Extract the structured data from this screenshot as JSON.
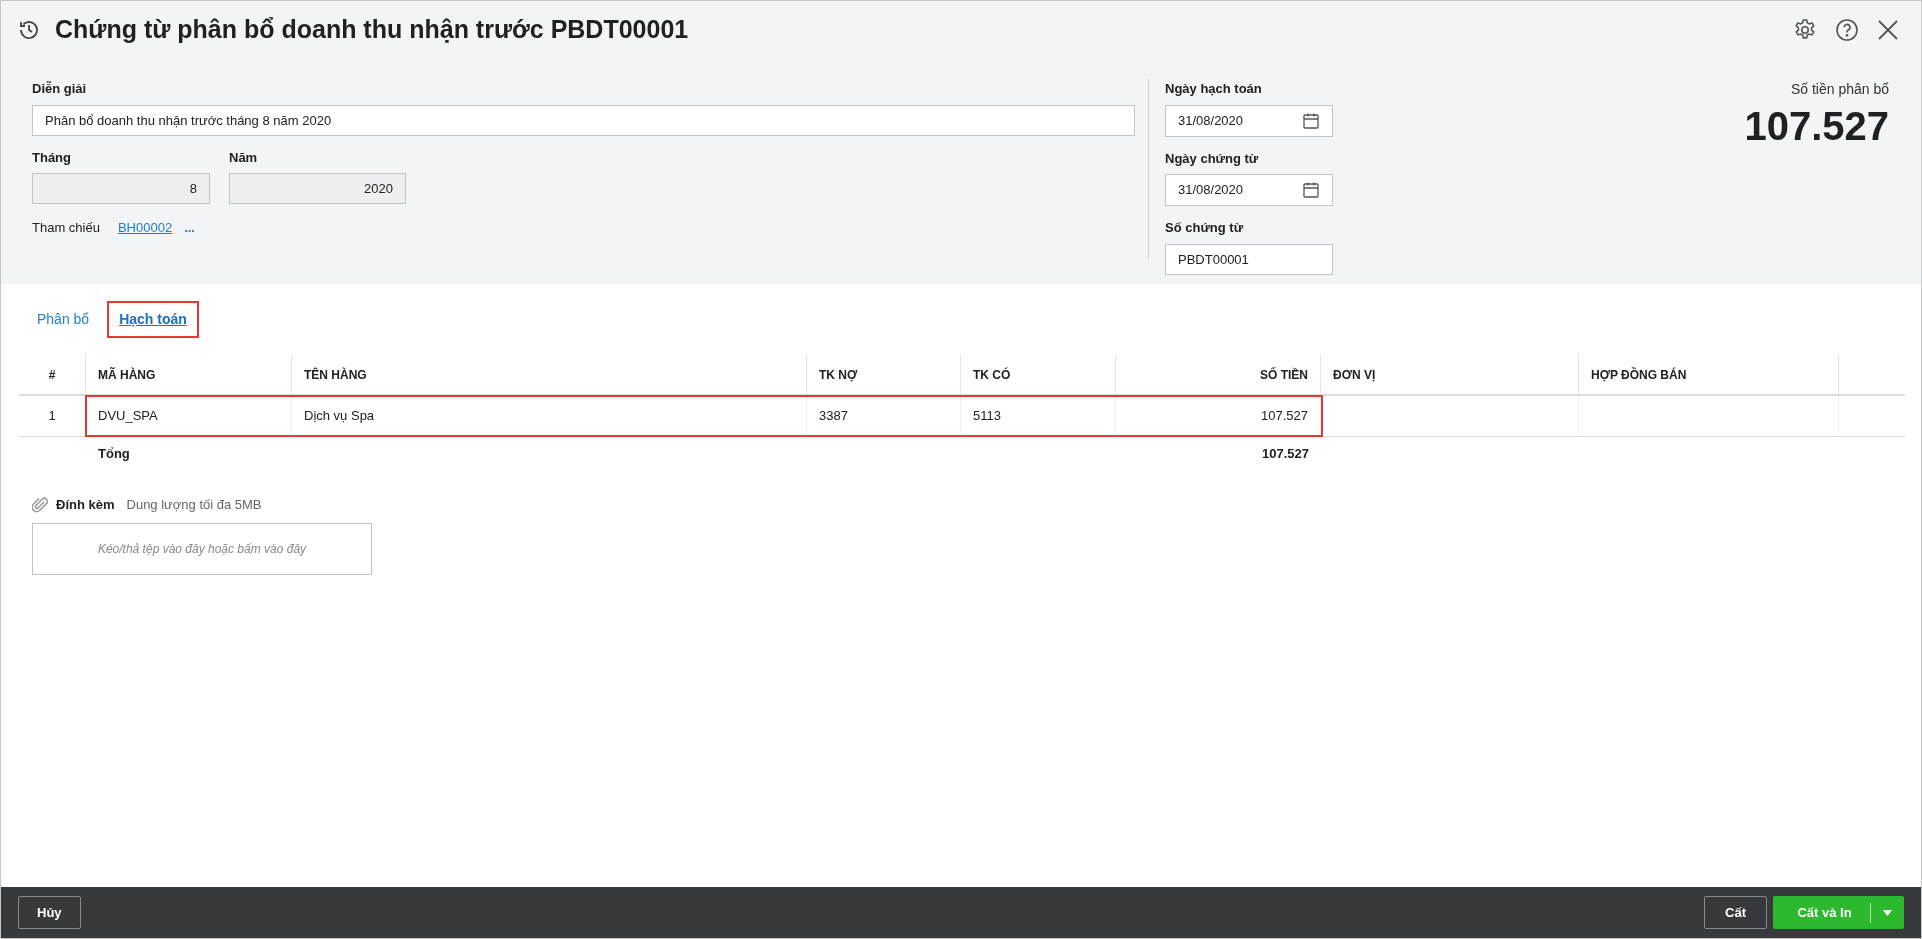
{
  "window": {
    "title": "Chứng từ phân bổ doanh thu nhận trước PBDT00001"
  },
  "form": {
    "description": {
      "label": "Diễn giải",
      "value": "Phân bổ doanh thu nhận trước tháng 8 năm 2020"
    },
    "month": {
      "label": "Tháng",
      "value": "8",
      "disabled": true
    },
    "year": {
      "label": "Năm",
      "value": "2020",
      "disabled": true
    },
    "reference": {
      "label": "Tham chiếu",
      "link": "BH00002",
      "more": "..."
    },
    "posting_date": {
      "label": "Ngày hạch toán",
      "value": "31/08/2020"
    },
    "voucher_date": {
      "label": "Ngày chứng từ",
      "value": "31/08/2020"
    },
    "voucher_number": {
      "label": "Số chứng từ",
      "value": "PBDT00001"
    }
  },
  "amount": {
    "label": "Số tiền phân bổ",
    "value": "107.527"
  },
  "tabs": [
    {
      "label": "Phân bổ",
      "selected": false,
      "highlighted": false
    },
    {
      "label": "Hạch toán",
      "selected": true,
      "highlighted": true
    }
  ],
  "table": {
    "columns": [
      "#",
      "MÃ HÀNG",
      "TÊN HÀNG",
      "TK NỢ",
      "TK CÓ",
      "SỐ TIỀN",
      "ĐƠN VỊ",
      "HỢP ĐỒNG BÁN"
    ],
    "rows": [
      {
        "cells": [
          "1",
          "DVU_SPA",
          "Dịch vụ Spa",
          "3387",
          "5113",
          "107.527",
          "",
          ""
        ],
        "highlighted": true
      }
    ],
    "total": {
      "label": "Tổng",
      "value": "107.527"
    }
  },
  "attachment": {
    "label": "Đính kèm",
    "hint": "Dung lượng tối đa 5MB",
    "dropzone": "Kéo/thả tệp vào đây hoặc bấm vào đây"
  },
  "footer": {
    "cancel": "Hủy",
    "save": "Cất",
    "save_print": "Cất và In"
  }
}
